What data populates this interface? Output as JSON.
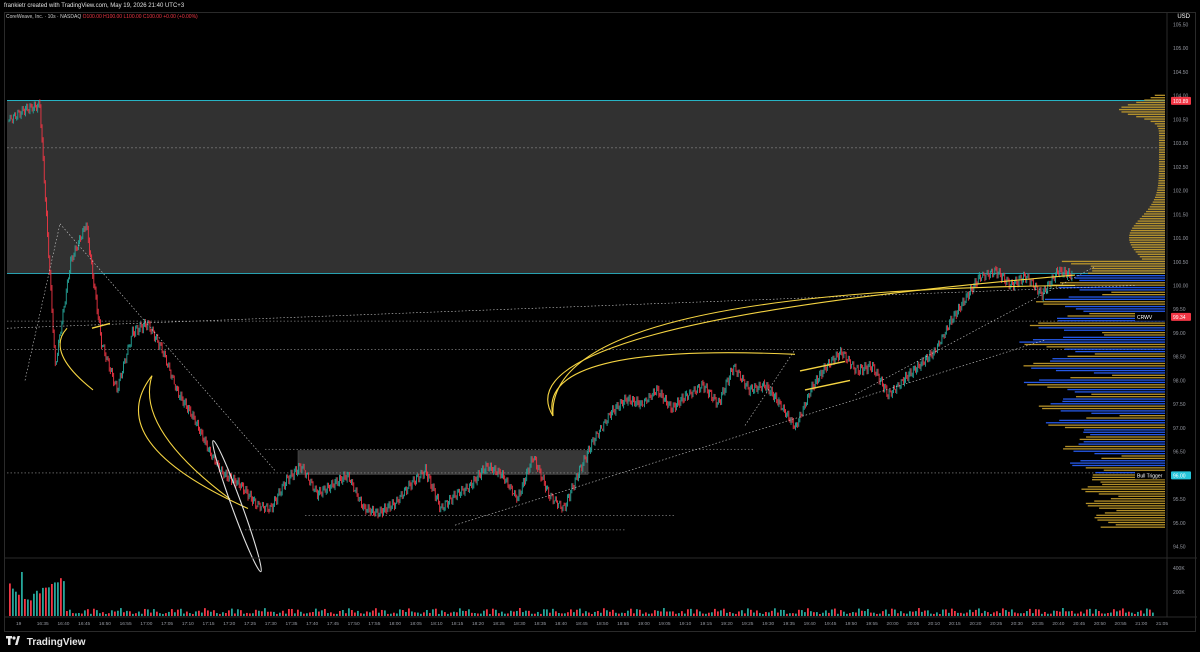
{
  "header": {
    "attribution": "frankietr created with TradingView.com, May 19, 2026 21:40 UTC+3",
    "symbol_line": "CoreWeave, Inc. · 10s · NASDAQ",
    "ohlc": "O100.00 H100.00 L100.00 C100.00 +0.00 (+0.00%)",
    "currency": "USD"
  },
  "brand": {
    "name": "TradingView"
  },
  "colors": {
    "up": "#26a69a",
    "down": "#f23645",
    "drawing": "#f5d442",
    "zone": "#3a3a3a",
    "volume_profile_blue": "#2962ff",
    "volume_profile_gold": "#c8a02c"
  },
  "chart_data": {
    "type": "candlestick",
    "y_axis_ticks": [
      "105.50",
      "105.00",
      "104.50",
      "104.00",
      "103.50",
      "103.00",
      "102.50",
      "102.00",
      "101.50",
      "101.00",
      "100.50",
      "100.00",
      "99.50",
      "99.00",
      "98.50",
      "98.00",
      "97.50",
      "97.00",
      "96.50",
      "96.00",
      "95.50",
      "95.00",
      "94.50"
    ],
    "ylim": [
      94.3,
      105.7
    ],
    "x_axis_ticks": [
      "19",
      "16:35",
      "16:40",
      "16:45",
      "16:50",
      "16:55",
      "17:00",
      "17:05",
      "17:10",
      "17:15",
      "17:20",
      "17:25",
      "17:30",
      "17:35",
      "17:40",
      "17:45",
      "17:50",
      "17:55",
      "18:00",
      "18:05",
      "18:10",
      "18:15",
      "18:20",
      "18:25",
      "18:30",
      "18:35",
      "18:40",
      "18:45",
      "18:50",
      "18:55",
      "19:00",
      "19:05",
      "19:10",
      "19:15",
      "19:20",
      "19:25",
      "19:30",
      "19:35",
      "19:40",
      "19:45",
      "19:50",
      "19:55",
      "20:00",
      "20:05",
      "20:10",
      "20:15",
      "20:20",
      "20:25",
      "20:30",
      "20:35",
      "20:40",
      "20:45",
      "20:50",
      "20:55",
      "21:00",
      "21:05"
    ],
    "price_path": [
      [
        0,
        103.5
      ],
      [
        1,
        103.7
      ],
      [
        2,
        103.8
      ],
      [
        3,
        98.3
      ],
      [
        4,
        100.5
      ],
      [
        5,
        101.3
      ],
      [
        6,
        98.8
      ],
      [
        7,
        97.8
      ],
      [
        8,
        99.0
      ],
      [
        9,
        99.2
      ],
      [
        10,
        98.6
      ],
      [
        11,
        97.7
      ],
      [
        12,
        97.2
      ],
      [
        13,
        96.5
      ],
      [
        14,
        96.0
      ],
      [
        15,
        95.8
      ],
      [
        16,
        95.4
      ],
      [
        17,
        95.3
      ],
      [
        18,
        95.9
      ],
      [
        19,
        96.2
      ],
      [
        20,
        95.6
      ],
      [
        21,
        95.8
      ],
      [
        22,
        96.0
      ],
      [
        23,
        95.3
      ],
      [
        24,
        95.2
      ],
      [
        25,
        95.4
      ],
      [
        26,
        95.8
      ],
      [
        27,
        96.1
      ],
      [
        28,
        95.3
      ],
      [
        29,
        95.6
      ],
      [
        30,
        95.8
      ],
      [
        31,
        96.2
      ],
      [
        32,
        96.0
      ],
      [
        33,
        95.5
      ],
      [
        34,
        96.4
      ],
      [
        35,
        95.6
      ],
      [
        36,
        95.3
      ],
      [
        37,
        96.1
      ],
      [
        38,
        96.8
      ],
      [
        39,
        97.3
      ],
      [
        40,
        97.6
      ],
      [
        41,
        97.5
      ],
      [
        42,
        97.8
      ],
      [
        43,
        97.4
      ],
      [
        44,
        97.7
      ],
      [
        45,
        97.9
      ],
      [
        46,
        97.5
      ],
      [
        47,
        98.3
      ],
      [
        48,
        97.8
      ],
      [
        49,
        97.9
      ],
      [
        50,
        97.5
      ],
      [
        51,
        97.0
      ],
      [
        52,
        97.8
      ],
      [
        53,
        98.3
      ],
      [
        54,
        98.6
      ],
      [
        55,
        98.2
      ],
      [
        56,
        98.3
      ],
      [
        57,
        97.7
      ],
      [
        58,
        98.0
      ],
      [
        59,
        98.3
      ],
      [
        60,
        98.6
      ],
      [
        61,
        99.2
      ],
      [
        62,
        99.7
      ],
      [
        63,
        100.2
      ],
      [
        64,
        100.3
      ],
      [
        65,
        100.0
      ],
      [
        66,
        100.2
      ],
      [
        67,
        99.8
      ],
      [
        68,
        100.3
      ],
      [
        69,
        100.2
      ]
    ],
    "volume_axis_ticks": [
      "400K",
      "200K"
    ],
    "markers": [
      {
        "label": "Bull Trigger",
        "value": "96.00"
      },
      {
        "label": "CRWV",
        "value": "99.34"
      },
      {
        "label": "",
        "value": "103.89"
      }
    ],
    "annotations": [
      "resistance zone 100.25–103.90",
      "box 96.02–96.52 (17:33–18:40)"
    ],
    "grid": false,
    "legend": "none"
  }
}
